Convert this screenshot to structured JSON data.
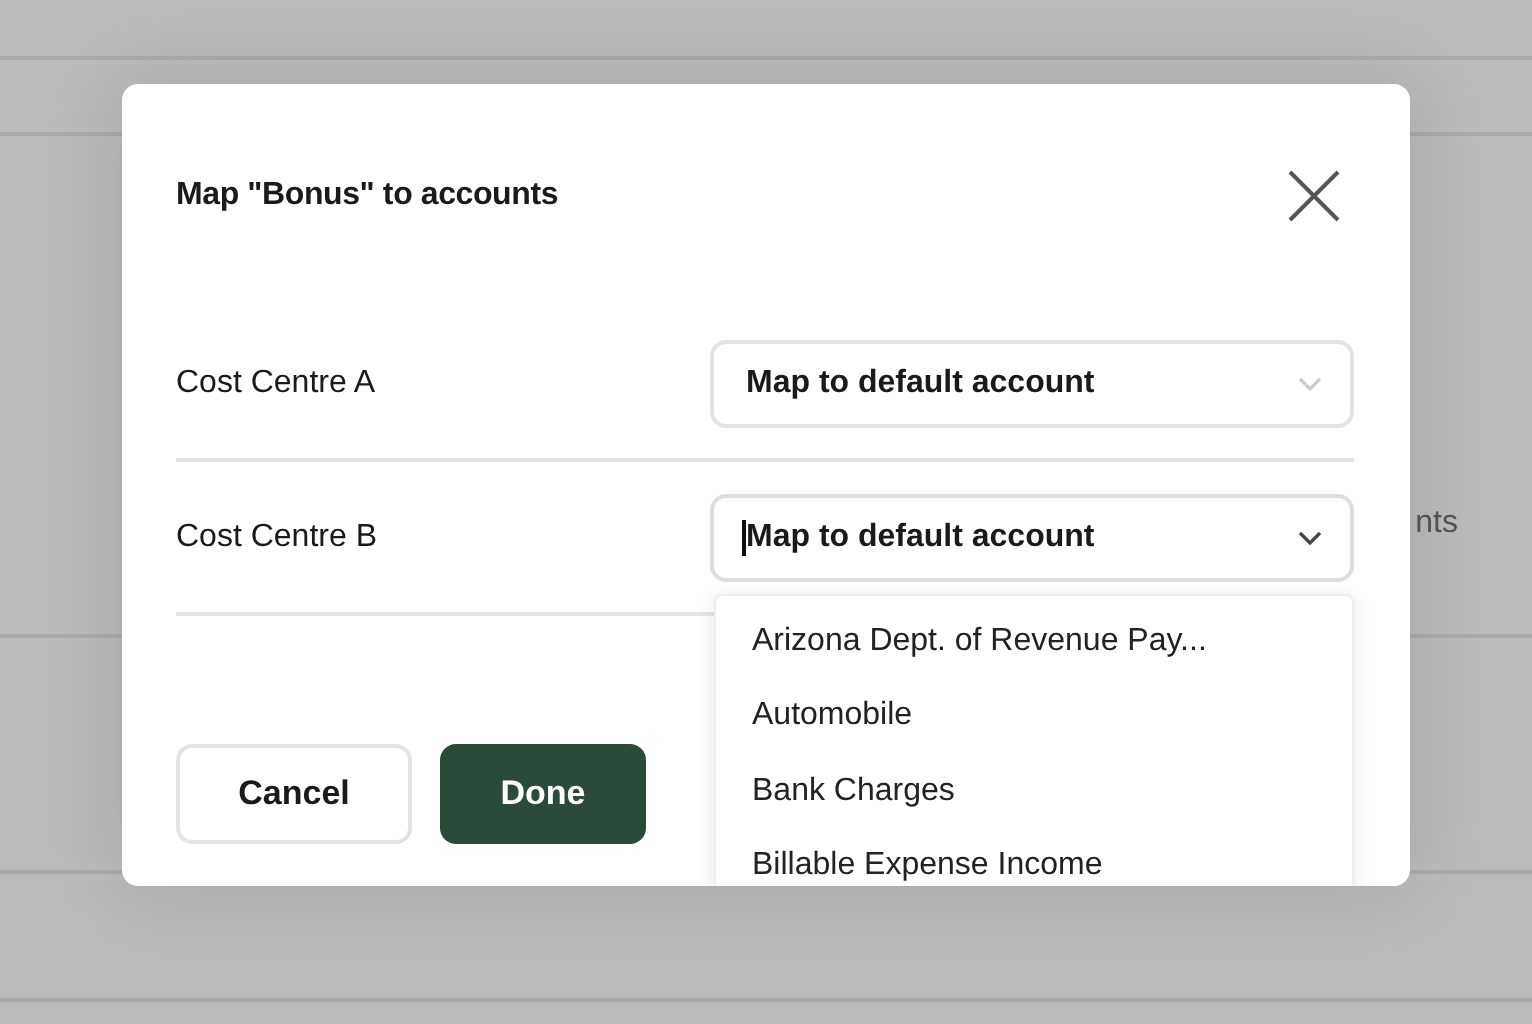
{
  "background": {
    "text_fragment": "nts"
  },
  "dialog": {
    "title": "Map \"Bonus\" to accounts",
    "rows": [
      {
        "label": "Cost Centre A",
        "select": {
          "value": "Map to default account",
          "focused": false
        }
      },
      {
        "label": "Cost Centre B",
        "select": {
          "value": "Map to default account",
          "focused": true,
          "options": [
            "Arizona Dept. of Revenue Pay...",
            "Automobile",
            "Bank Charges",
            "Billable Expense Income"
          ]
        }
      }
    ],
    "buttons": [
      {
        "label": "Cancel",
        "kind": "secondary"
      },
      {
        "label": "Done",
        "kind": "primary"
      }
    ]
  }
}
